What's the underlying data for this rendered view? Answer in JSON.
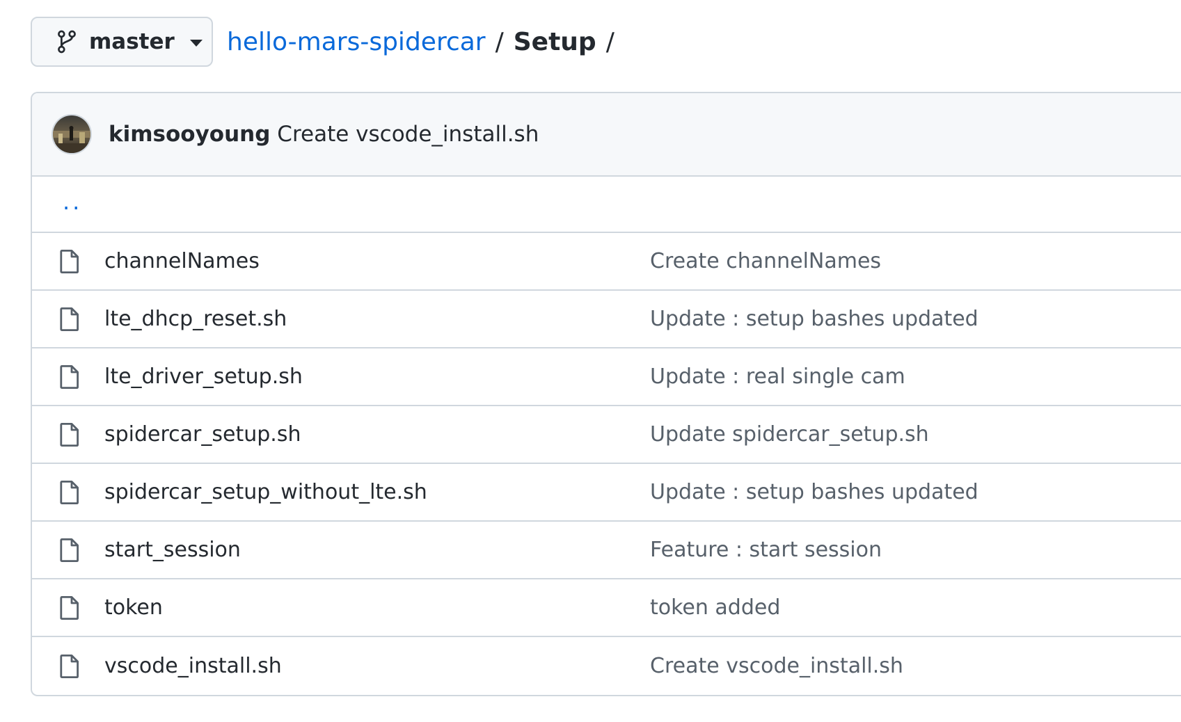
{
  "branch": {
    "label": "master",
    "icon": "git-branch-icon"
  },
  "breadcrumb": {
    "repo": "hello-mars-spidercar",
    "separator": "/",
    "directory": "Setup",
    "trailing_separator": "/"
  },
  "latest_commit": {
    "author": "kimsooyoung",
    "message": "Create vscode_install.sh"
  },
  "parent_dir": "..",
  "files": [
    {
      "name": "channelNames",
      "message": "Create channelNames",
      "icon": "file-icon"
    },
    {
      "name": "lte_dhcp_reset.sh",
      "message": "Update : setup bashes updated",
      "icon": "file-icon"
    },
    {
      "name": "lte_driver_setup.sh",
      "message": "Update : real single cam",
      "icon": "file-icon"
    },
    {
      "name": "spidercar_setup.sh",
      "message": "Update spidercar_setup.sh",
      "icon": "file-icon"
    },
    {
      "name": "spidercar_setup_without_lte.sh",
      "message": "Update : setup bashes updated",
      "icon": "file-icon"
    },
    {
      "name": "start_session",
      "message": "Feature : start session",
      "icon": "file-icon"
    },
    {
      "name": "token",
      "message": "token added",
      "icon": "file-icon"
    },
    {
      "name": "vscode_install.sh",
      "message": "Create vscode_install.sh",
      "icon": "file-icon"
    }
  ],
  "colors": {
    "link": "#0969da",
    "border": "#d0d7de",
    "header_bg": "#f6f8fa",
    "muted_text": "#57606a",
    "text": "#24292f"
  }
}
